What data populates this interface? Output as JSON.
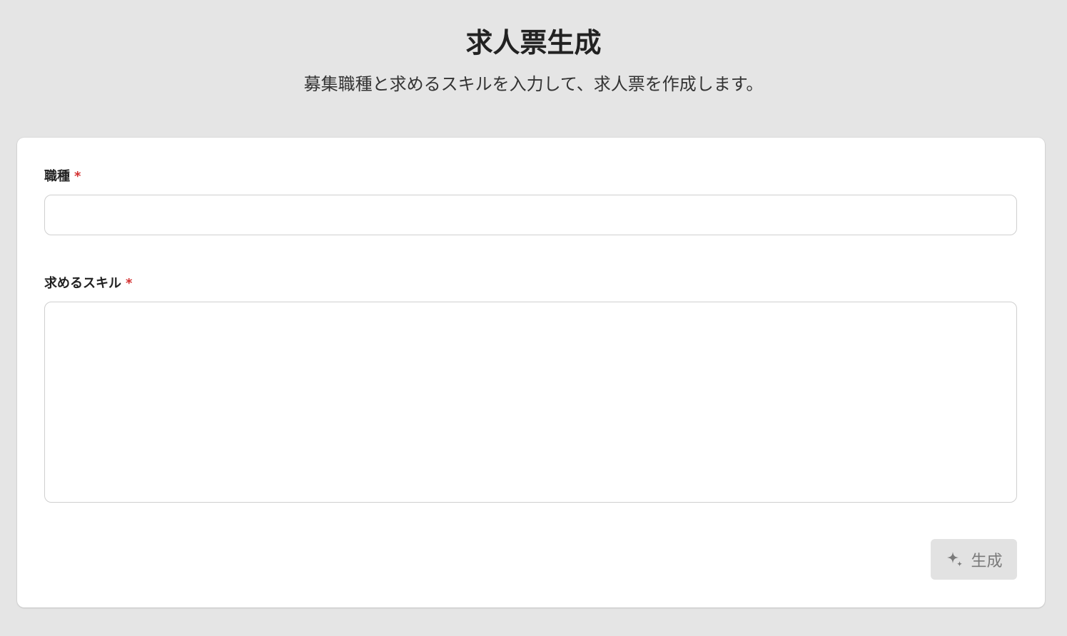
{
  "header": {
    "title": "求人票生成",
    "subtitle": "募集職種と求めるスキルを入力して、求人票を作成します。"
  },
  "form": {
    "job_field": {
      "label": "職種",
      "required_mark": "*",
      "value": "",
      "placeholder": ""
    },
    "skills_field": {
      "label": "求めるスキル",
      "required_mark": "*",
      "value": "",
      "placeholder": ""
    },
    "generate_button": {
      "label": "生成",
      "icon": "sparkle-icon",
      "state": "disabled"
    }
  },
  "colors": {
    "background": "#e5e5e5",
    "card": "#ffffff",
    "required": "#d32f2f",
    "button_disabled_bg": "#e2e2e2",
    "button_disabled_text": "#7a7a7a"
  }
}
